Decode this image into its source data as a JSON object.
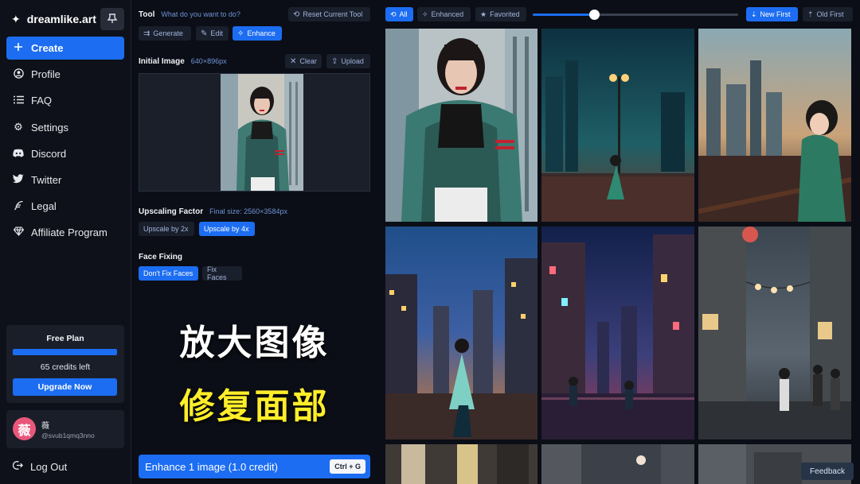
{
  "brand": {
    "name": "dreamlike.art",
    "logo_icon": "sparkle-icon",
    "pin_icon": "pin-icon"
  },
  "sidebar": {
    "items": [
      {
        "label": "Create",
        "icon": "plus-icon",
        "glyph": "+",
        "active": true
      },
      {
        "label": "Profile",
        "icon": "user-icon",
        "glyph": "◉"
      },
      {
        "label": "FAQ",
        "icon": "list-icon",
        "glyph": "☰"
      },
      {
        "label": "Settings",
        "icon": "gear-icon",
        "glyph": "⚙"
      },
      {
        "label": "Discord",
        "icon": "discord-icon",
        "glyph": "◈"
      },
      {
        "label": "Twitter",
        "icon": "twitter-icon",
        "glyph": "✦"
      },
      {
        "label": "Legal",
        "icon": "feather-icon",
        "glyph": "✎"
      },
      {
        "label": "Affiliate Program",
        "icon": "gem-icon",
        "glyph": "♦"
      }
    ],
    "plan": {
      "title": "Free Plan",
      "credits_text": "65 credits left",
      "progress": 1.0,
      "upgrade_label": "Upgrade Now"
    },
    "user": {
      "avatar_text": "薇",
      "name": "薇",
      "handle": "@svub1qmq3nno"
    },
    "logout_label": "Log Out"
  },
  "panel": {
    "tool": {
      "label": "Tool",
      "prompt": "What do you want to do?",
      "reset_label": "Reset Current Tool",
      "tabs": [
        {
          "label": "Generate",
          "icon": "wand-icon",
          "active": false
        },
        {
          "label": "Edit",
          "icon": "pencil-icon",
          "active": false
        },
        {
          "label": "Enhance",
          "icon": "magic-icon",
          "active": true
        }
      ]
    },
    "initial_image": {
      "label": "Initial Image",
      "size": "640×896px",
      "clear_label": "Clear",
      "upload_label": "Upload"
    },
    "upscaling": {
      "label": "Upscaling Factor",
      "final_size": "Final size: 2560×3584px",
      "options": [
        {
          "label": "Upscale by 2x",
          "active": false
        },
        {
          "label": "Upscale by 4x",
          "active": true
        }
      ]
    },
    "face_fixing": {
      "label": "Face Fixing",
      "options": [
        {
          "label": "Don't Fix Faces",
          "active": true
        },
        {
          "label": "Fix Faces",
          "active": false
        }
      ]
    },
    "overlay": {
      "line1": "放大图像",
      "line2": "修复面部"
    },
    "enhance_button": {
      "label": "Enhance 1 image (1.0 credit)",
      "shortcut": "Ctrl + G"
    }
  },
  "gallery": {
    "filters": [
      {
        "label": "All",
        "icon": "history-icon",
        "active": true
      },
      {
        "label": "Enhanced",
        "icon": "magic-icon",
        "active": false
      },
      {
        "label": "Favorited",
        "icon": "star-icon",
        "active": false
      }
    ],
    "zoom": 0.3,
    "sort": [
      {
        "label": "New First",
        "icon": "sort-desc-icon",
        "active": true
      },
      {
        "label": "Old First",
        "icon": "sort-asc-icon",
        "active": false
      }
    ],
    "feedback_label": "Feedback"
  },
  "colors": {
    "accent": "#1c6df2",
    "bg": "#0b0e16",
    "sidebar_bg": "#0e1119",
    "card_bg": "#1a1e29",
    "overlay_yellow": "#ffee2a"
  }
}
